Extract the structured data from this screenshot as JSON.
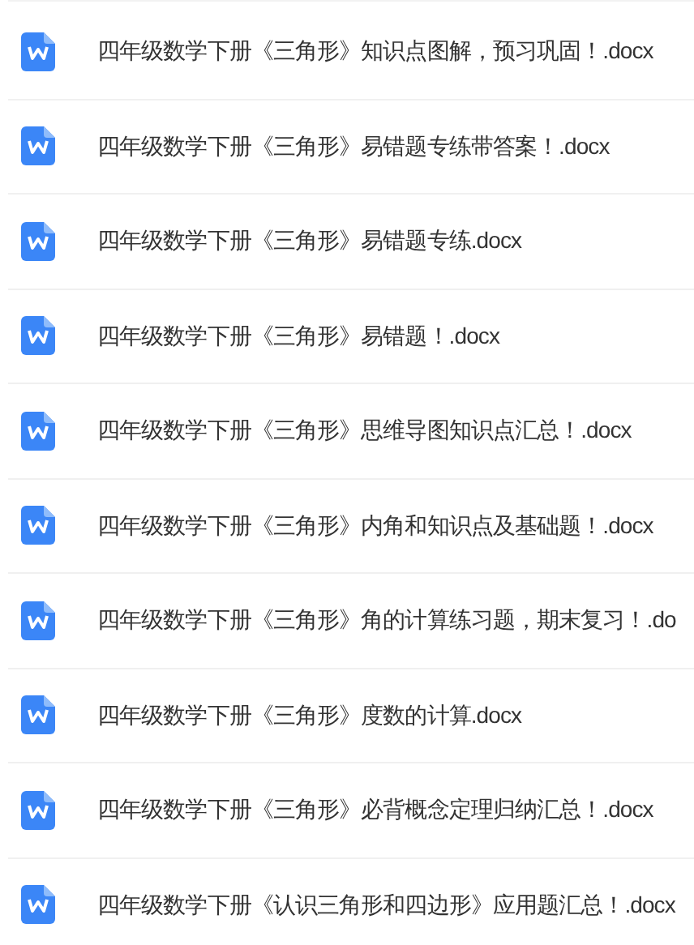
{
  "files": [
    {
      "name": "四年级数学下册《三角形》知识点图解，预习巩固！.docx"
    },
    {
      "name": "四年级数学下册《三角形》易错题专练带答案！.docx"
    },
    {
      "name": "四年级数学下册《三角形》易错题专练.docx"
    },
    {
      "name": "四年级数学下册《三角形》易错题！.docx"
    },
    {
      "name": "四年级数学下册《三角形》思维导图知识点汇总！.docx"
    },
    {
      "name": "四年级数学下册《三角形》内角和知识点及基础题！.docx"
    },
    {
      "name": "四年级数学下册《三角形》角的计算练习题，期末复习！.do"
    },
    {
      "name": "四年级数学下册《三角形》度数的计算.docx"
    },
    {
      "name": "四年级数学下册《三角形》必背概念定理归纳汇总！.docx"
    },
    {
      "name": "四年级数学下册《认识三角形和四边形》应用题汇总！.docx"
    }
  ]
}
